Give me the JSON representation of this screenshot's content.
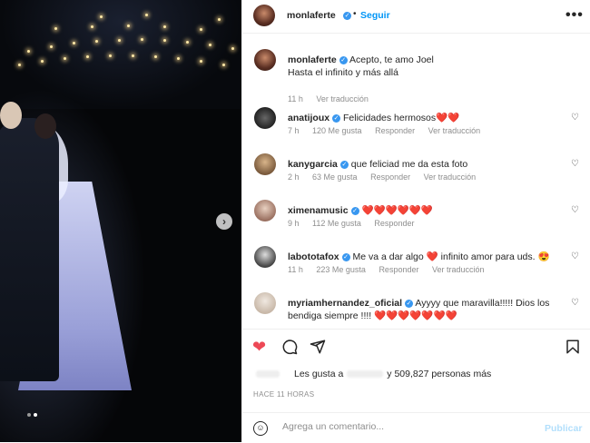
{
  "post": {
    "author": "monlaferte",
    "follow_label": "Seguir",
    "separator": "•",
    "more_label": "•••"
  },
  "media": {
    "next_label": "›",
    "slides": 2,
    "active_slide": 2
  },
  "comments": [
    {
      "user": "monlaferte",
      "text": "Acepto, te amo Joel\nHasta el infinito y más allá",
      "time": "11 h",
      "translate": "Ver traducción"
    },
    {
      "user": "anatijoux",
      "text": "Felicidades hermosos",
      "hearts": "❤️❤️",
      "time": "7 h",
      "likes": "120 Me gusta",
      "reply": "Responder",
      "translate": "Ver traducción"
    },
    {
      "user": "kanygarcia",
      "text": "que feliciad me da esta foto",
      "time": "2 h",
      "likes": "63 Me gusta",
      "reply": "Responder",
      "translate": "Ver traducción"
    },
    {
      "user": "ximenamusic",
      "text": "",
      "hearts": "❤️❤️❤️❤️❤️❤️",
      "time": "9 h",
      "likes": "112 Me gusta",
      "reply": "Responder"
    },
    {
      "user": "labototafox",
      "text": "Me va a dar algo",
      "text2": "infinito amor para uds.",
      "emoji": "😍",
      "time": "11 h",
      "likes": "223 Me gusta",
      "reply": "Responder",
      "translate": "Ver traducción"
    },
    {
      "user": "myriamhernandez_oficial",
      "text": "Ayyyy que maravilla!!!!! Dios los bendiga siempre !!!!",
      "hearts": "❤️❤️❤️❤️❤️❤️❤️"
    }
  ],
  "likes": {
    "prefix": "Les gusta a",
    "suffix": "y 509,827 personas más"
  },
  "timestamp": "HACE 11 HORAS",
  "add_comment": {
    "placeholder": "Agrega un comentario...",
    "publish_label": "Publicar"
  },
  "colors": {
    "accent": "#0095f6",
    "like_red": "#ed4956",
    "muted": "#8e8e8e"
  }
}
